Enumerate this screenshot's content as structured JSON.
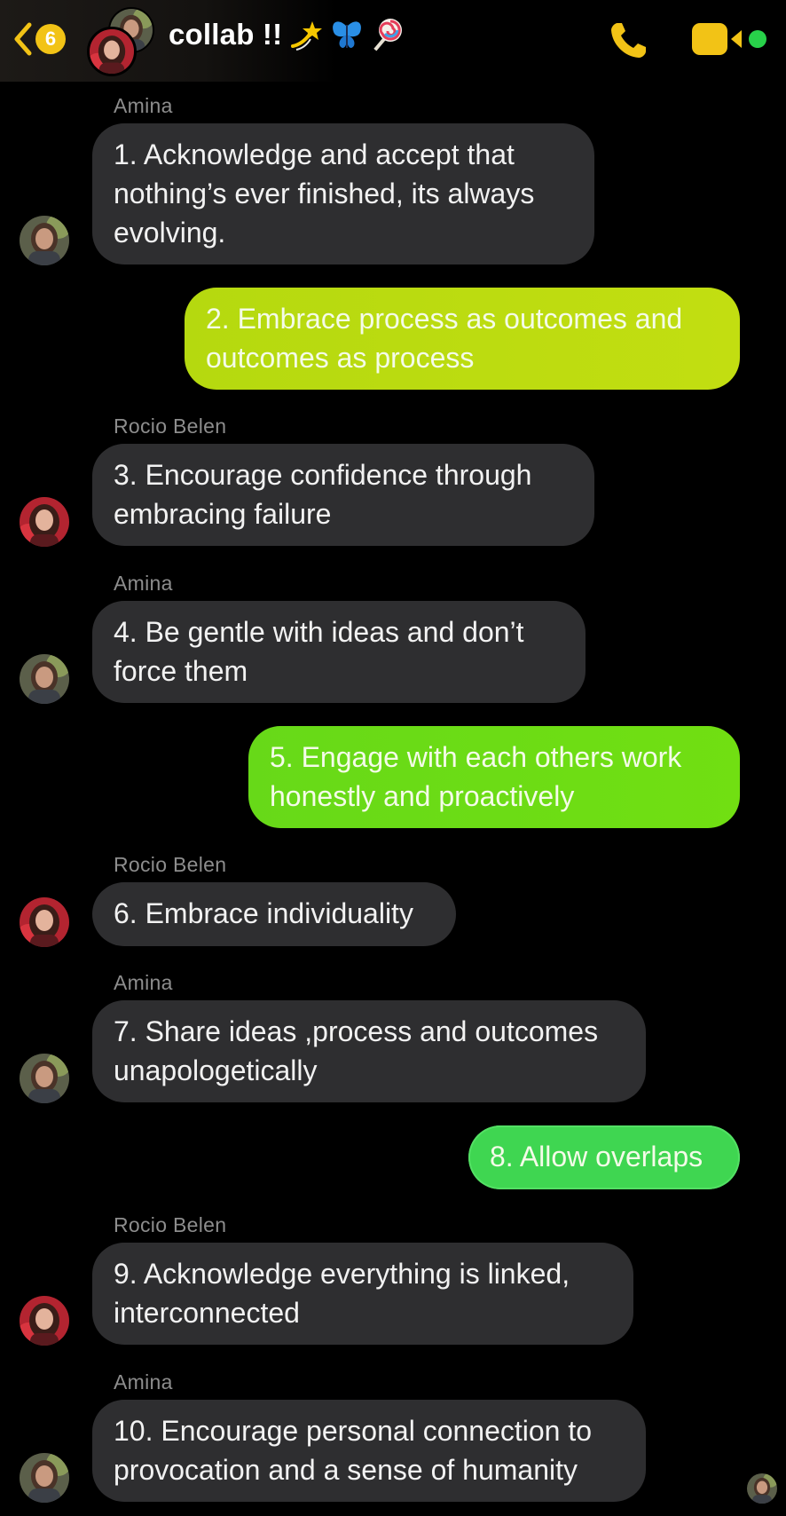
{
  "header": {
    "back_badge": "6",
    "title": "collab !!",
    "emojis": [
      "dizzy-emoji",
      "butterfly-emoji",
      "lollipop-emoji"
    ]
  },
  "colors": {
    "accent": "#f2c316",
    "bubble_in": "#2e2e30",
    "bubble_lime": "#b9dc10",
    "bubble_green": "#6bdc15",
    "bubble_mint": "#3fd651",
    "online": "#28d14a"
  },
  "messages": [
    {
      "sender": "Amina",
      "text": "1. Acknowledge and accept  that nothing’s ever finished, its always evolving."
    },
    {
      "sender": "",
      "text": "2. Embrace process as outcomes and outcomes as process"
    },
    {
      "sender": "Rocio Belen",
      "text": "3. Encourage confidence through embracing failure"
    },
    {
      "sender": "Amina",
      "text": "4. Be gentle with ideas and don’t force them"
    },
    {
      "sender": "",
      "text": "5. Engage with each others work honestly and proactively"
    },
    {
      "sender": "Rocio Belen",
      "text": "6. Embrace individuality"
    },
    {
      "sender": "Amina",
      "text": "7. Share ideas ,process and outcomes unapologetically"
    },
    {
      "sender": "",
      "text": "8. Allow overlaps"
    },
    {
      "sender": "Rocio Belen",
      "text": "9. Acknowledge everything is linked, interconnected"
    },
    {
      "sender": "Amina",
      "text": "10. Encourage personal connection to provocation and a sense of humanity"
    }
  ]
}
